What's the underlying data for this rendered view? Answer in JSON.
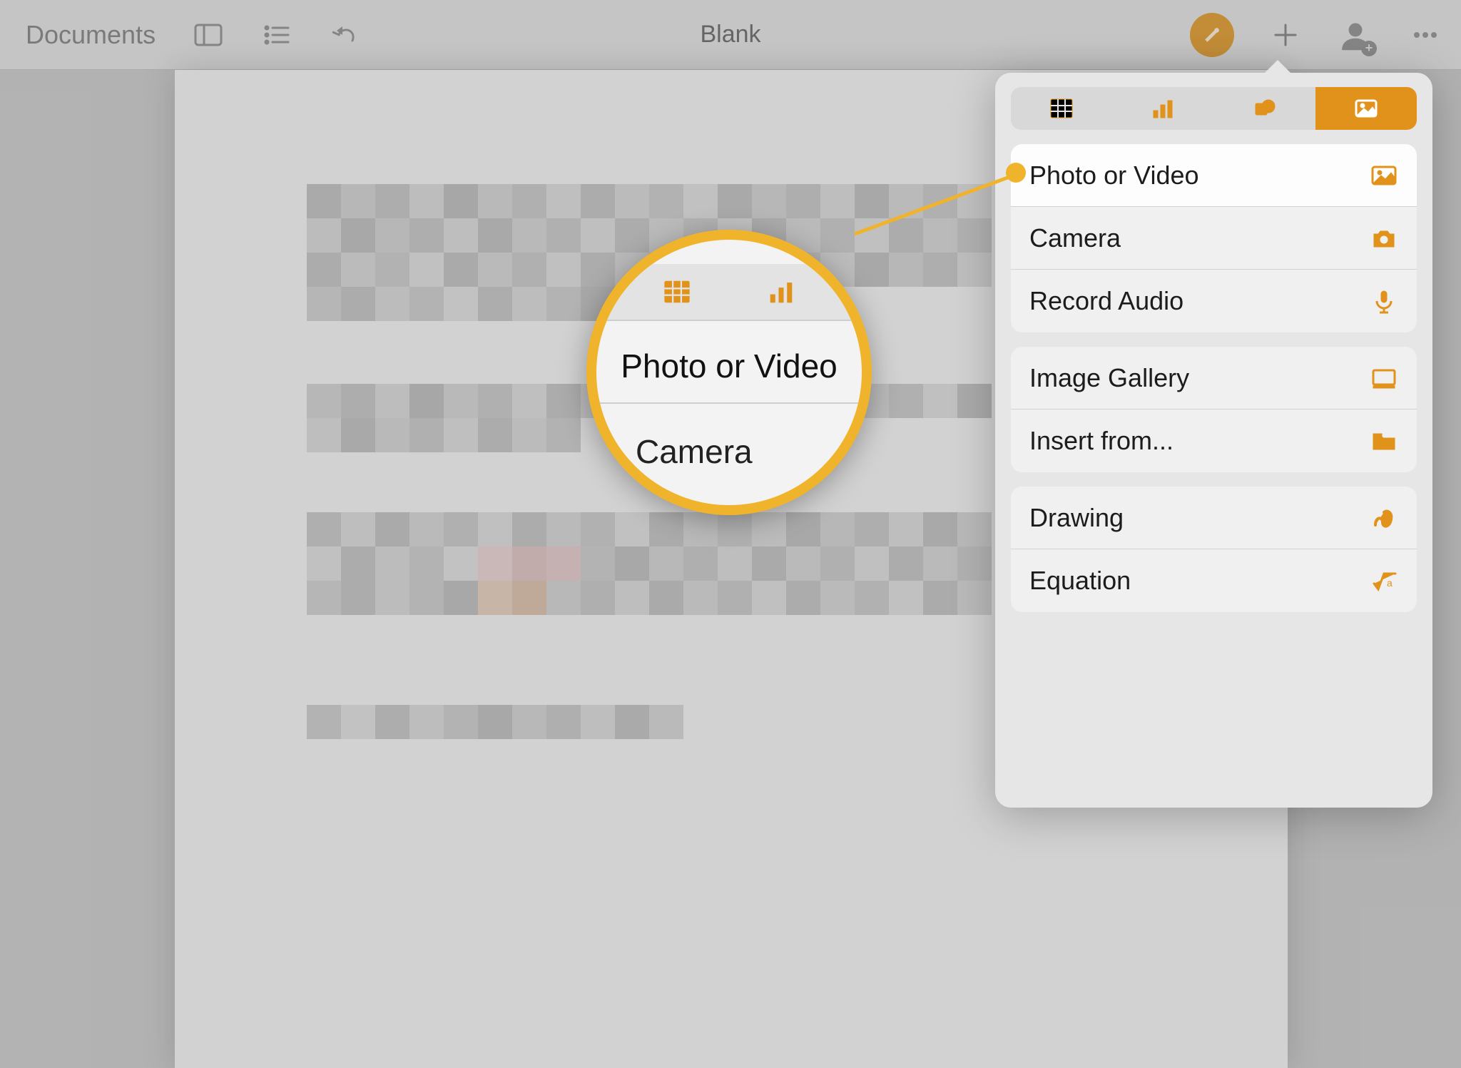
{
  "toolbar": {
    "documents_label": "Documents",
    "title": "Blank"
  },
  "popover": {
    "tabs": {
      "table": "table",
      "chart": "chart",
      "shape": "shape",
      "media": "media"
    },
    "group1": [
      {
        "label": "Photo or Video",
        "icon": "photo"
      },
      {
        "label": "Camera",
        "icon": "camera"
      },
      {
        "label": "Record Audio",
        "icon": "mic"
      }
    ],
    "group2": [
      {
        "label": "Image Gallery",
        "icon": "gallery"
      },
      {
        "label": "Insert from...",
        "icon": "folder"
      }
    ],
    "group3": [
      {
        "label": "Drawing",
        "icon": "squiggle"
      },
      {
        "label": "Equation",
        "icon": "sqrt"
      }
    ]
  },
  "magnifier": {
    "row1": "Photo or Video",
    "row2": "Camera"
  },
  "colors": {
    "accent": "#e0921a",
    "callout": "#f0b42c"
  }
}
